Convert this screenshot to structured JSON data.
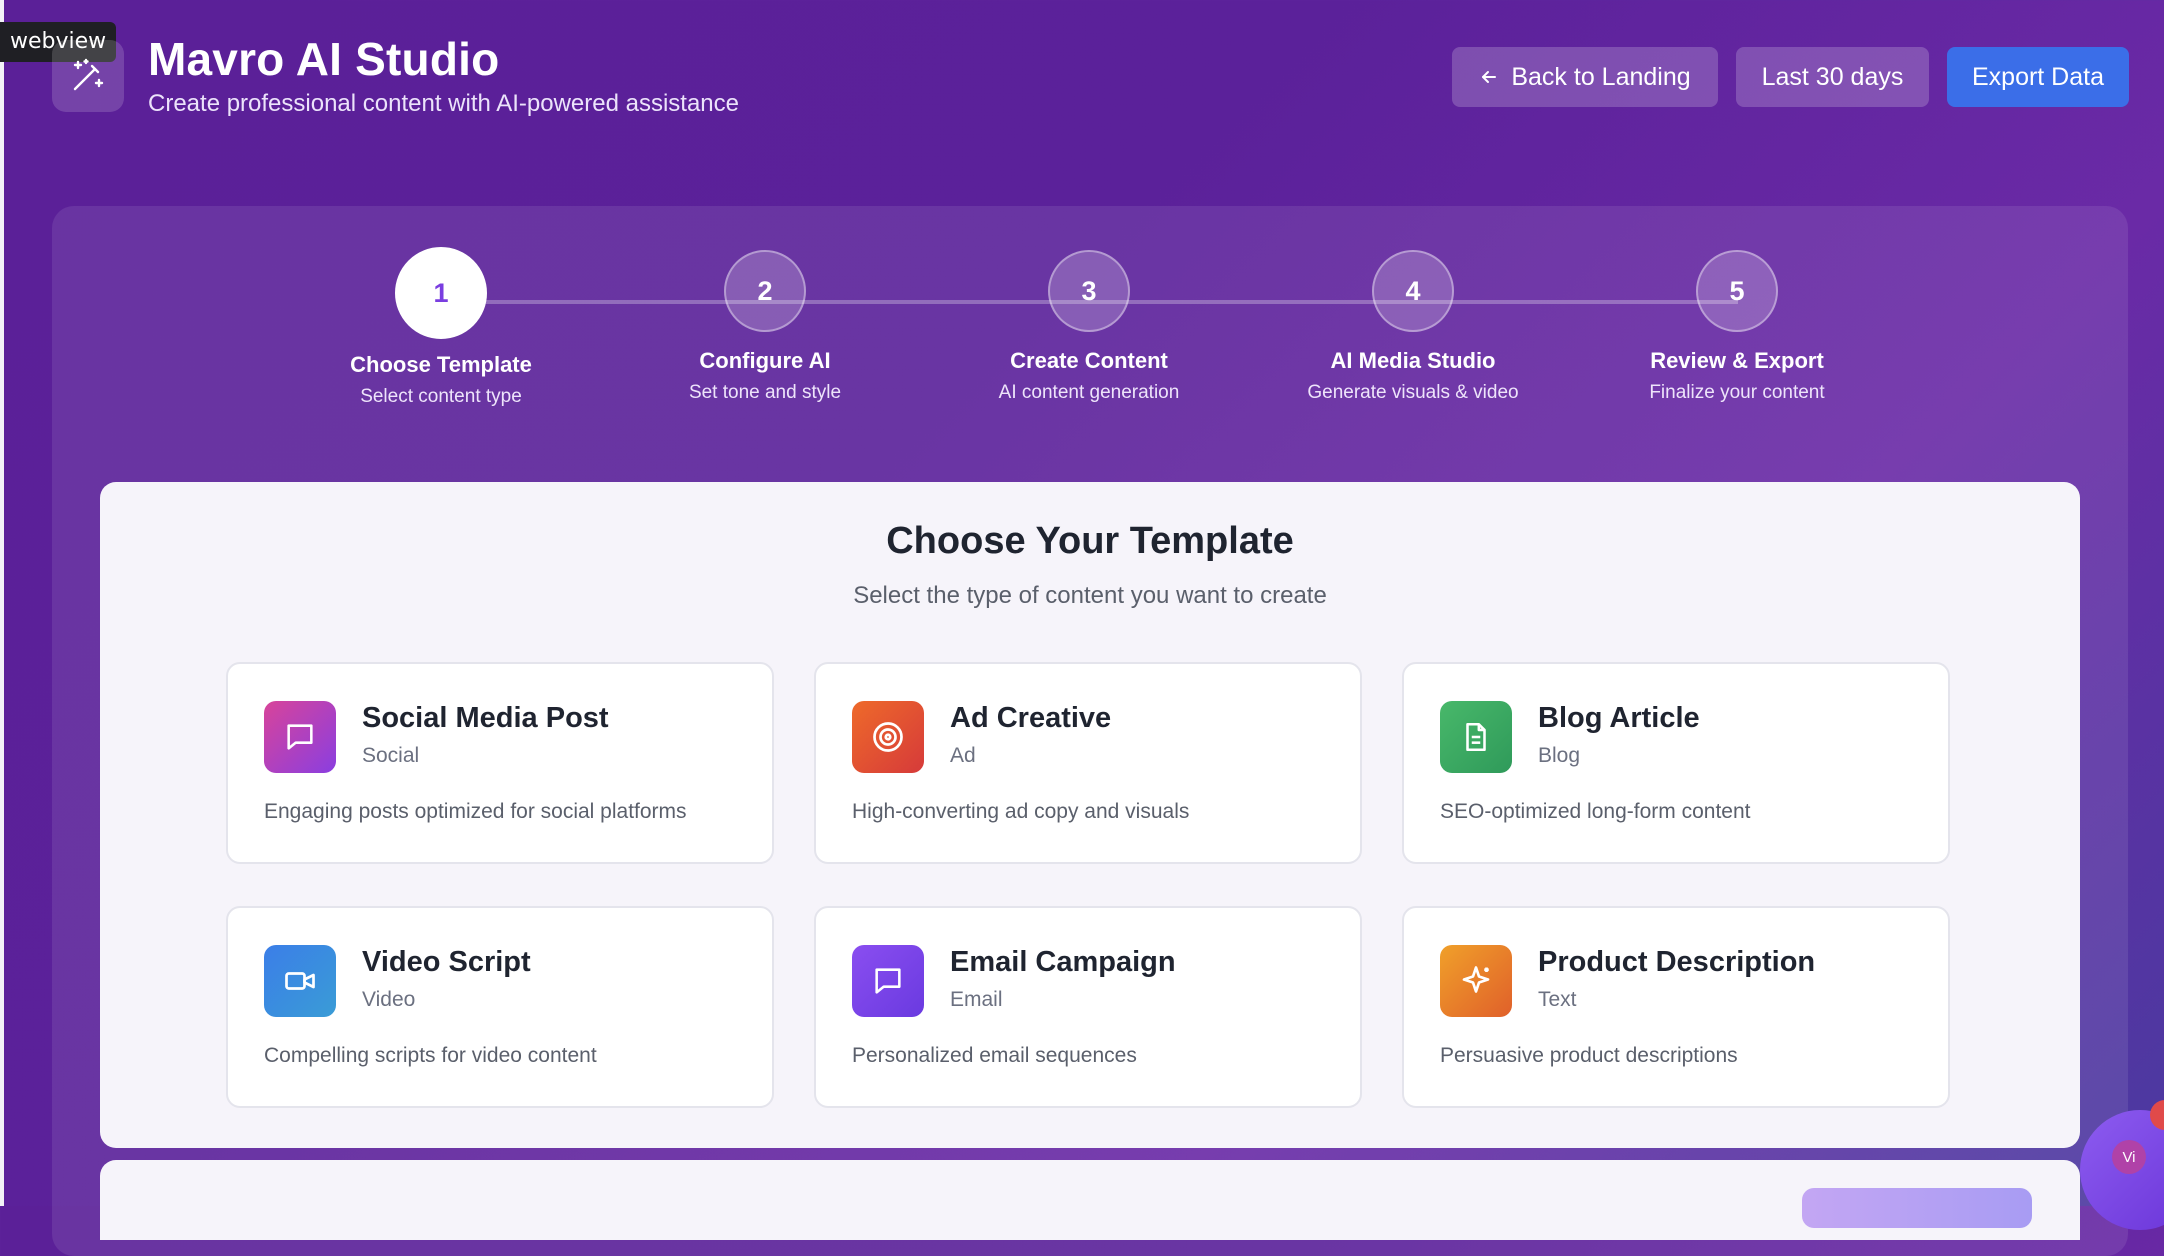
{
  "webview_tag": "webview",
  "header": {
    "title": "Mavro AI Studio",
    "subtitle": "Create professional content with AI-powered assistance",
    "logo_icon": "magic-wand-icon",
    "back_button_label": "Back to Landing",
    "back_button_icon": "arrow-left-icon",
    "range_button_label": "Last 30 days",
    "export_button_label": "Export Data"
  },
  "stepper": {
    "active_step": 1,
    "steps": [
      {
        "number": "1",
        "label": "Choose Template",
        "description": "Select content type"
      },
      {
        "number": "2",
        "label": "Configure AI",
        "description": "Set tone and style"
      },
      {
        "number": "3",
        "label": "Create Content",
        "description": "AI content generation"
      },
      {
        "number": "4",
        "label": "AI Media Studio",
        "description": "Generate visuals & video"
      },
      {
        "number": "5",
        "label": "Review & Export",
        "description": "Finalize your content"
      }
    ]
  },
  "template_section": {
    "title": "Choose Your Template",
    "subtitle": "Select the type of content you want to create",
    "templates": [
      {
        "name": "Social Media Post",
        "category": "Social",
        "description": "Engaging posts optimized for social platforms",
        "icon": "message-square-icon",
        "gradient": [
          "#d8449a",
          "#8a3ee0"
        ]
      },
      {
        "name": "Ad Creative",
        "category": "Ad",
        "description": "High-converting ad copy and visuals",
        "icon": "target-icon",
        "gradient": [
          "#ee6a2a",
          "#d63a3a"
        ]
      },
      {
        "name": "Blog Article",
        "category": "Blog",
        "description": "SEO-optimized long-form content",
        "icon": "file-text-icon",
        "gradient": [
          "#48b86a",
          "#2f9a5a"
        ]
      },
      {
        "name": "Video Script",
        "category": "Video",
        "description": "Compelling scripts for video content",
        "icon": "video-camera-icon",
        "gradient": [
          "#3b7ee8",
          "#3a9cd6"
        ]
      },
      {
        "name": "Email Campaign",
        "category": "Email",
        "description": "Personalized email sequences",
        "icon": "message-square-icon",
        "gradient": [
          "#8a4ef0",
          "#6a3ae0"
        ]
      },
      {
        "name": "Product Description",
        "category": "Text",
        "description": "Persuasive product descriptions",
        "icon": "sparkle-icon",
        "gradient": [
          "#f0a02a",
          "#e0602a"
        ]
      }
    ]
  },
  "chat_widget": {
    "avatar_initials": "Vi"
  },
  "colors": {
    "accent": "#7a3ee0",
    "export_button": "#3b6ee8"
  }
}
